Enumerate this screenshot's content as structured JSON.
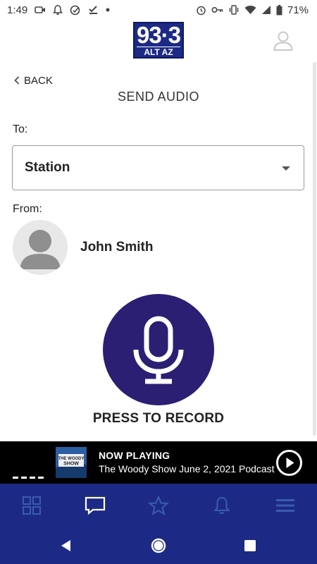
{
  "status_bar": {
    "time": "1:49",
    "battery": "71%"
  },
  "header": {
    "logo_number": "93·3",
    "logo_sub": "ALT AZ"
  },
  "nav": {
    "back_label": "BACK"
  },
  "page": {
    "title": "SEND AUDIO"
  },
  "form": {
    "to_label": "To:",
    "to_value": "Station",
    "from_label": "From:",
    "from_name": "John Smith"
  },
  "record": {
    "label": "PRESS TO RECORD"
  },
  "now_playing": {
    "heading": "NOW PLAYING",
    "title": "The Woody Show June 2, 2021 Podcast",
    "art_text": "THE WOODY SHOW"
  },
  "bottom_nav": {
    "items": [
      "grid-icon",
      "message-icon",
      "star-icon",
      "bell-icon",
      "menu-icon"
    ]
  },
  "colors": {
    "brand": "#1c2a86",
    "record": "#2a1f73",
    "player_bg": "#000000"
  }
}
